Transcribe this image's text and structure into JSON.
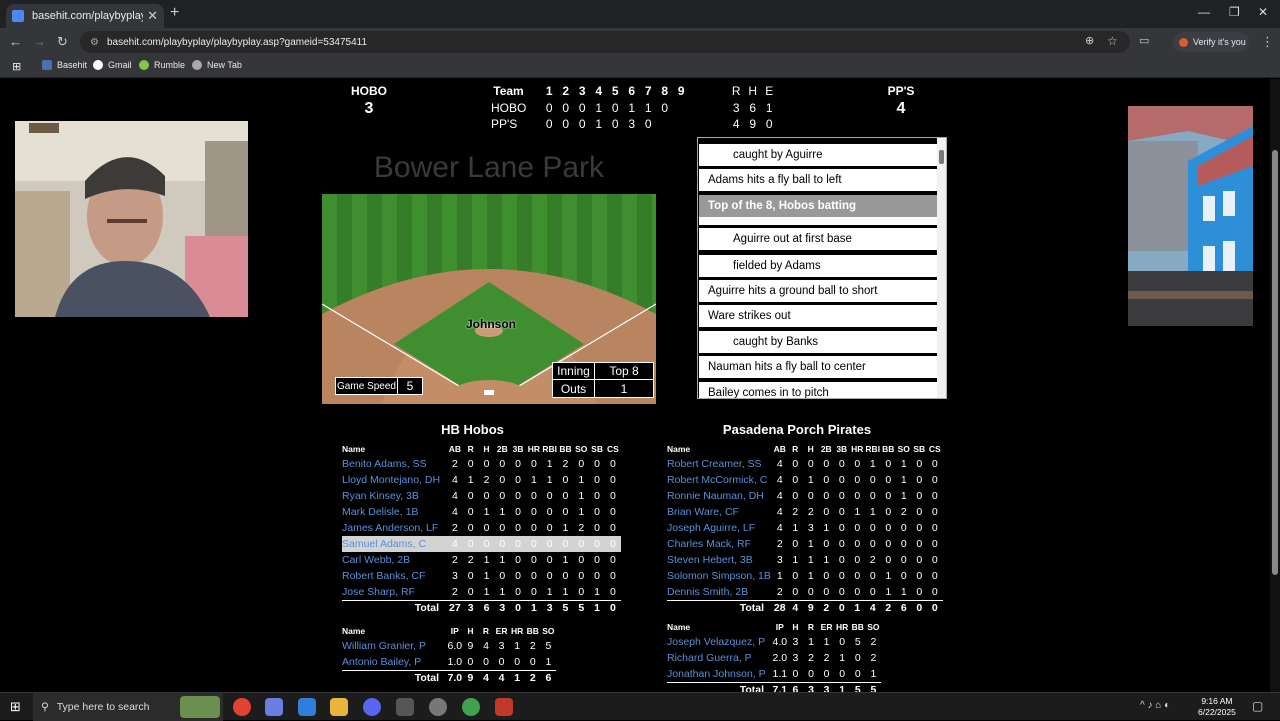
{
  "browser": {
    "tab_title": "basehit.com/playbyplay/playbyp",
    "url": "basehit.com/playbyplay/playbyplay.asp?gameid=53475411",
    "verify_label": "Verify it's you",
    "bookmarks": [
      "Basehit",
      "Gmail",
      "Rumble",
      "New Tab"
    ]
  },
  "scoreboard": {
    "away_label": "HOBO",
    "away_score": "3",
    "home_label": "PP'S",
    "home_score": "4",
    "team_header": "Team",
    "innings": [
      "1",
      "2",
      "3",
      "4",
      "5",
      "6",
      "7",
      "8",
      "9"
    ],
    "rhe_header": [
      "R",
      "H",
      "E"
    ],
    "away_row": {
      "team": "HOBO",
      "innings": [
        "0",
        "0",
        "0",
        "1",
        "0",
        "1",
        "1",
        "0"
      ],
      "rhe": [
        "3",
        "6",
        "1"
      ]
    },
    "home_row": {
      "team": "PP'S",
      "innings": [
        "0",
        "0",
        "0",
        "1",
        "0",
        "3",
        "0"
      ],
      "rhe": [
        "4",
        "9",
        "0"
      ]
    }
  },
  "field": {
    "park_name": "Bower Lane Park",
    "batter": "Johnson",
    "game_speed_label": "Game Speed",
    "game_speed": "5",
    "inning_label": "Inning",
    "inning_value": "Top 8",
    "outs_label": "Outs",
    "outs_value": "1"
  },
  "play_by_play": [
    {
      "text": "caught by Aguirre",
      "indent": true,
      "highlight": false
    },
    {
      "text": "Adams hits a fly ball to left",
      "indent": false,
      "highlight": false
    },
    {
      "text": "Top of the 8, Hobos batting",
      "indent": false,
      "highlight": true
    },
    {
      "text": "",
      "indent": false,
      "highlight": false
    },
    {
      "text": "Aguirre out at first base",
      "indent": true,
      "highlight": false
    },
    {
      "text": "fielded by Adams",
      "indent": true,
      "highlight": false
    },
    {
      "text": "Aguirre hits a ground ball to short",
      "indent": false,
      "highlight": false
    },
    {
      "text": "Ware strikes out",
      "indent": false,
      "highlight": false
    },
    {
      "text": "caught by Banks",
      "indent": true,
      "highlight": false
    },
    {
      "text": "Nauman hits a fly ball to center",
      "indent": false,
      "highlight": false
    },
    {
      "text": "Bailey comes in to pitch",
      "indent": false,
      "highlight": false
    }
  ],
  "away_box": {
    "team": "HB Hobos",
    "bat_headers": [
      "Name",
      "AB",
      "R",
      "H",
      "2B",
      "3B",
      "HR",
      "RBI",
      "BB",
      "SO",
      "SB",
      "CS"
    ],
    "batters": [
      [
        "Benito Adams, SS",
        "2",
        "0",
        "0",
        "0",
        "0",
        "0",
        "1",
        "2",
        "0",
        "0",
        "0"
      ],
      [
        "Lloyd Montejano, DH",
        "4",
        "1",
        "2",
        "0",
        "0",
        "1",
        "1",
        "0",
        "1",
        "0",
        "0"
      ],
      [
        "Ryan Kinsey, 3B",
        "4",
        "0",
        "0",
        "0",
        "0",
        "0",
        "0",
        "0",
        "1",
        "0",
        "0"
      ],
      [
        "Mark Delisle, 1B",
        "4",
        "0",
        "1",
        "1",
        "0",
        "0",
        "0",
        "0",
        "1",
        "0",
        "0"
      ],
      [
        "James Anderson, LF",
        "2",
        "0",
        "0",
        "0",
        "0",
        "0",
        "0",
        "1",
        "2",
        "0",
        "0"
      ],
      [
        "Samuel Adams, C",
        "4",
        "0",
        "0",
        "0",
        "0",
        "0",
        "0",
        "0",
        "0",
        "0",
        "0"
      ],
      [
        "Carl Webb, 2B",
        "2",
        "2",
        "1",
        "1",
        "0",
        "0",
        "0",
        "1",
        "0",
        "0",
        "0"
      ],
      [
        "Robert Banks, CF",
        "3",
        "0",
        "1",
        "0",
        "0",
        "0",
        "0",
        "0",
        "0",
        "0",
        "0"
      ],
      [
        "Jose Sharp, RF",
        "2",
        "0",
        "1",
        "1",
        "0",
        "0",
        "1",
        "1",
        "0",
        "1",
        "0"
      ]
    ],
    "selected_batter": 5,
    "bat_total": [
      "Total",
      "27",
      "3",
      "6",
      "3",
      "0",
      "1",
      "3",
      "5",
      "5",
      "1",
      "0"
    ],
    "pitch_headers": [
      "Name",
      "IP",
      "H",
      "R",
      "ER",
      "HR",
      "BB",
      "SO"
    ],
    "pitchers": [
      [
        "William Granier, P",
        "6.0",
        "9",
        "4",
        "3",
        "1",
        "2",
        "5"
      ],
      [
        "Antonio Bailey, P",
        "1.0",
        "0",
        "0",
        "0",
        "0",
        "0",
        "1"
      ]
    ],
    "pitch_total": [
      "Total",
      "7.0",
      "9",
      "4",
      "4",
      "1",
      "2",
      "6"
    ]
  },
  "home_box": {
    "team": "Pasadena Porch Pirates",
    "bat_headers": [
      "Name",
      "AB",
      "R",
      "H",
      "2B",
      "3B",
      "HR",
      "RBI",
      "BB",
      "SO",
      "SB",
      "CS"
    ],
    "batters": [
      [
        "Robert Creamer, SS",
        "4",
        "0",
        "0",
        "0",
        "0",
        "0",
        "1",
        "0",
        "1",
        "0",
        "0"
      ],
      [
        "Robert McCormick, C",
        "4",
        "0",
        "1",
        "0",
        "0",
        "0",
        "0",
        "0",
        "1",
        "0",
        "0"
      ],
      [
        "Ronnie Nauman, DH",
        "4",
        "0",
        "0",
        "0",
        "0",
        "0",
        "0",
        "0",
        "1",
        "0",
        "0"
      ],
      [
        "Brian Ware, CF",
        "4",
        "2",
        "2",
        "0",
        "0",
        "1",
        "1",
        "0",
        "2",
        "0",
        "0"
      ],
      [
        "Joseph Aguirre, LF",
        "4",
        "1",
        "3",
        "1",
        "0",
        "0",
        "0",
        "0",
        "0",
        "0",
        "0"
      ],
      [
        "Charles Mack, RF",
        "2",
        "0",
        "1",
        "0",
        "0",
        "0",
        "0",
        "0",
        "0",
        "0",
        "0"
      ],
      [
        "Steven Hebert, 3B",
        "3",
        "1",
        "1",
        "1",
        "0",
        "0",
        "2",
        "0",
        "0",
        "0",
        "0"
      ],
      [
        "Solomon Simpson, 1B",
        "1",
        "0",
        "1",
        "0",
        "0",
        "0",
        "0",
        "1",
        "0",
        "0",
        "0"
      ],
      [
        "Dennis Smith, 2B",
        "2",
        "0",
        "0",
        "0",
        "0",
        "0",
        "0",
        "1",
        "1",
        "0",
        "0"
      ]
    ],
    "bat_total": [
      "Total",
      "28",
      "4",
      "9",
      "2",
      "0",
      "1",
      "4",
      "2",
      "6",
      "0",
      "0"
    ],
    "pitch_headers": [
      "Name",
      "IP",
      "H",
      "R",
      "ER",
      "HR",
      "BB",
      "SO"
    ],
    "pitchers": [
      [
        "Joseph Velazquez, P",
        "4.0",
        "3",
        "1",
        "1",
        "0",
        "5",
        "2"
      ],
      [
        "Richard Guerra, P",
        "2.0",
        "3",
        "2",
        "2",
        "1",
        "0",
        "2"
      ],
      [
        "Jonathan Johnson, P",
        "1.1",
        "0",
        "0",
        "0",
        "0",
        "0",
        "1"
      ]
    ],
    "pitch_total": [
      "Total",
      "7.1",
      "6",
      "3",
      "3",
      "1",
      "5",
      "5"
    ]
  },
  "taskbar": {
    "search_placeholder": "Type here to search",
    "time": "9:16 AM",
    "date": "6/22/2025"
  }
}
